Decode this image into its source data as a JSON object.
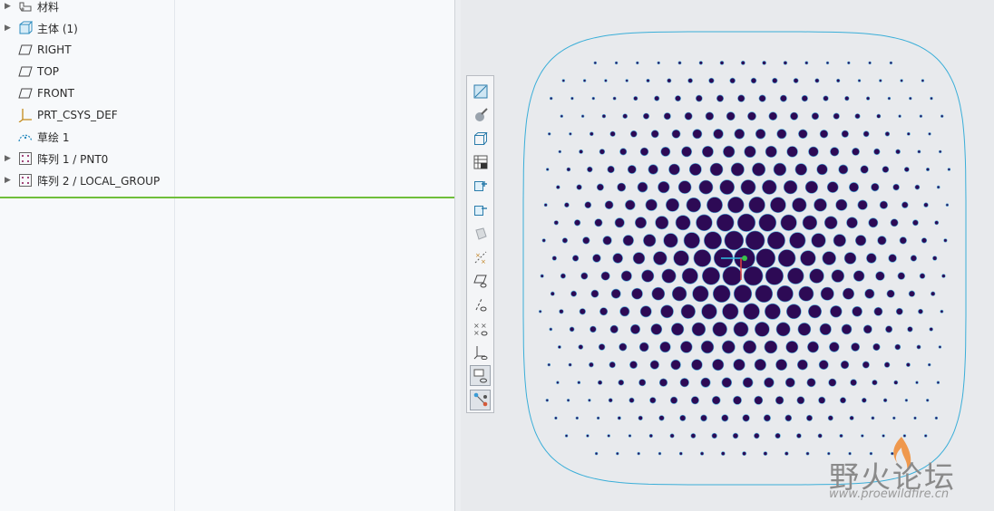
{
  "model_tree": {
    "items": [
      {
        "label": "材料",
        "expandable": true,
        "icon": "materials-icon"
      },
      {
        "label": "主体 (1)",
        "expandable": true,
        "icon": "body-icon"
      },
      {
        "label": "RIGHT",
        "expandable": false,
        "icon": "datum-plane-icon"
      },
      {
        "label": "TOP",
        "expandable": false,
        "icon": "datum-plane-icon"
      },
      {
        "label": "FRONT",
        "expandable": false,
        "icon": "datum-plane-icon"
      },
      {
        "label": "PRT_CSYS_DEF",
        "expandable": false,
        "icon": "csys-icon"
      },
      {
        "label": "草绘 1",
        "expandable": false,
        "icon": "sketch-icon"
      },
      {
        "label": "阵列 1 / PNT0",
        "expandable": true,
        "icon": "pattern-icon"
      },
      {
        "label": "阵列 2 / LOCAL_GROUP",
        "expandable": true,
        "icon": "pattern-icon"
      }
    ]
  },
  "graphics_toolbar": {
    "buttons": [
      {
        "name": "refit-icon"
      },
      {
        "name": "display-style-icon"
      },
      {
        "name": "saved-orientations-icon"
      },
      {
        "name": "view-manager-icon"
      },
      {
        "name": "zoom-in-icon"
      },
      {
        "name": "zoom-out-icon"
      },
      {
        "name": "spin-center-icon"
      },
      {
        "name": "point-display-icon"
      },
      {
        "name": "plane-display-icon"
      },
      {
        "name": "axis-display-icon"
      },
      {
        "name": "point-tag-display-icon"
      },
      {
        "name": "csys-display-icon"
      },
      {
        "name": "annotation-display-icon",
        "pressed": true
      },
      {
        "name": "connect-display-icon",
        "pressed": true
      }
    ]
  },
  "colors": {
    "hole": "#2d0a55",
    "outline": "#3aaed8",
    "tree_divider_green": "#6fbf3a",
    "csys_x": "#e04040",
    "csys_y": "#2fc0e0",
    "csys_z": "#39c24a"
  },
  "watermark": {
    "title": "野火论坛",
    "url": "www.proewildfire.cn"
  }
}
